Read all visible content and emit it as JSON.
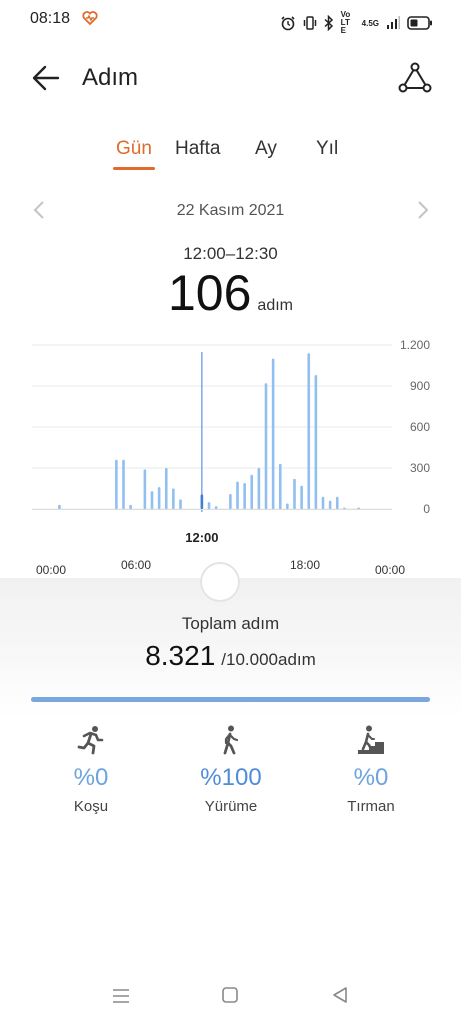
{
  "status_bar": {
    "time": "08:18",
    "icons": [
      "heart-rate-icon",
      "alarm-icon",
      "vibrate-icon",
      "bluetooth-icon",
      "volte-icon",
      "signal-icon",
      "battery-icon"
    ],
    "volte": "VoLTE",
    "network": "4.5G"
  },
  "header": {
    "title": "Adım"
  },
  "tabs": [
    {
      "label": "Gün",
      "active": true
    },
    {
      "label": "Hafta",
      "active": false
    },
    {
      "label": "Ay",
      "active": false
    },
    {
      "label": "Yıl",
      "active": false
    }
  ],
  "date_nav": {
    "date": "22 Kasım 2021"
  },
  "selection": {
    "range": "12:00–12:30",
    "value": "106",
    "unit": "adım"
  },
  "chart_data": {
    "type": "bar",
    "x_tick_labels": [
      "00:00",
      "06:00",
      "12:00",
      "18:00",
      "00:00"
    ],
    "selected_label": "12:00",
    "y_tick_labels": [
      "1.200",
      "900",
      "600",
      "300",
      "0"
    ],
    "ylim": [
      0,
      1200
    ],
    "bin_minutes": 30,
    "bins": [
      {
        "t": "01:30",
        "v": 30
      },
      {
        "t": "05:30",
        "v": 360
      },
      {
        "t": "06:00",
        "v": 360
      },
      {
        "t": "06:30",
        "v": 30
      },
      {
        "t": "07:30",
        "v": 290
      },
      {
        "t": "08:00",
        "v": 130
      },
      {
        "t": "08:30",
        "v": 160
      },
      {
        "t": "09:00",
        "v": 300
      },
      {
        "t": "09:30",
        "v": 150
      },
      {
        "t": "10:00",
        "v": 70
      },
      {
        "t": "11:30",
        "v": 106
      },
      {
        "t": "12:00",
        "v": 50
      },
      {
        "t": "12:30",
        "v": 20
      },
      {
        "t": "13:30",
        "v": 110
      },
      {
        "t": "14:00",
        "v": 200
      },
      {
        "t": "14:30",
        "v": 190
      },
      {
        "t": "15:00",
        "v": 250
      },
      {
        "t": "15:30",
        "v": 300
      },
      {
        "t": "16:00",
        "v": 920
      },
      {
        "t": "16:30",
        "v": 1100
      },
      {
        "t": "17:00",
        "v": 330
      },
      {
        "t": "17:30",
        "v": 40
      },
      {
        "t": "18:00",
        "v": 220
      },
      {
        "t": "18:30",
        "v": 170
      },
      {
        "t": "19:00",
        "v": 1140
      },
      {
        "t": "19:30",
        "v": 980
      },
      {
        "t": "20:00",
        "v": 90
      },
      {
        "t": "20:30",
        "v": 60
      },
      {
        "t": "21:00",
        "v": 90
      },
      {
        "t": "21:30",
        "v": 10
      },
      {
        "t": "22:30",
        "v": 10
      }
    ],
    "selected_bin": "11:30",
    "colors": {
      "bar": "#90bff0",
      "selected": "#3d7fd6",
      "grid": "#e9e9e9"
    }
  },
  "summary": {
    "label": "Toplam adım",
    "current": "8.321",
    "goal": "/10.000adım",
    "progress_fraction": 1.0
  },
  "activities": [
    {
      "icon": "running-icon",
      "percent": "%0",
      "label": "Koşu"
    },
    {
      "icon": "walking-icon",
      "percent": "%100",
      "label": "Yürüme"
    },
    {
      "icon": "climbing-icon",
      "percent": "%0",
      "label": "Tırman"
    }
  ],
  "nav": {
    "icons": [
      "menu-icon",
      "home-icon",
      "back-triangle-icon"
    ]
  },
  "colors": {
    "accent": "#e06b2c",
    "chart_bar": "#90bff0",
    "chart_selected": "#3d7fd6",
    "progress": "#7aa6de"
  }
}
